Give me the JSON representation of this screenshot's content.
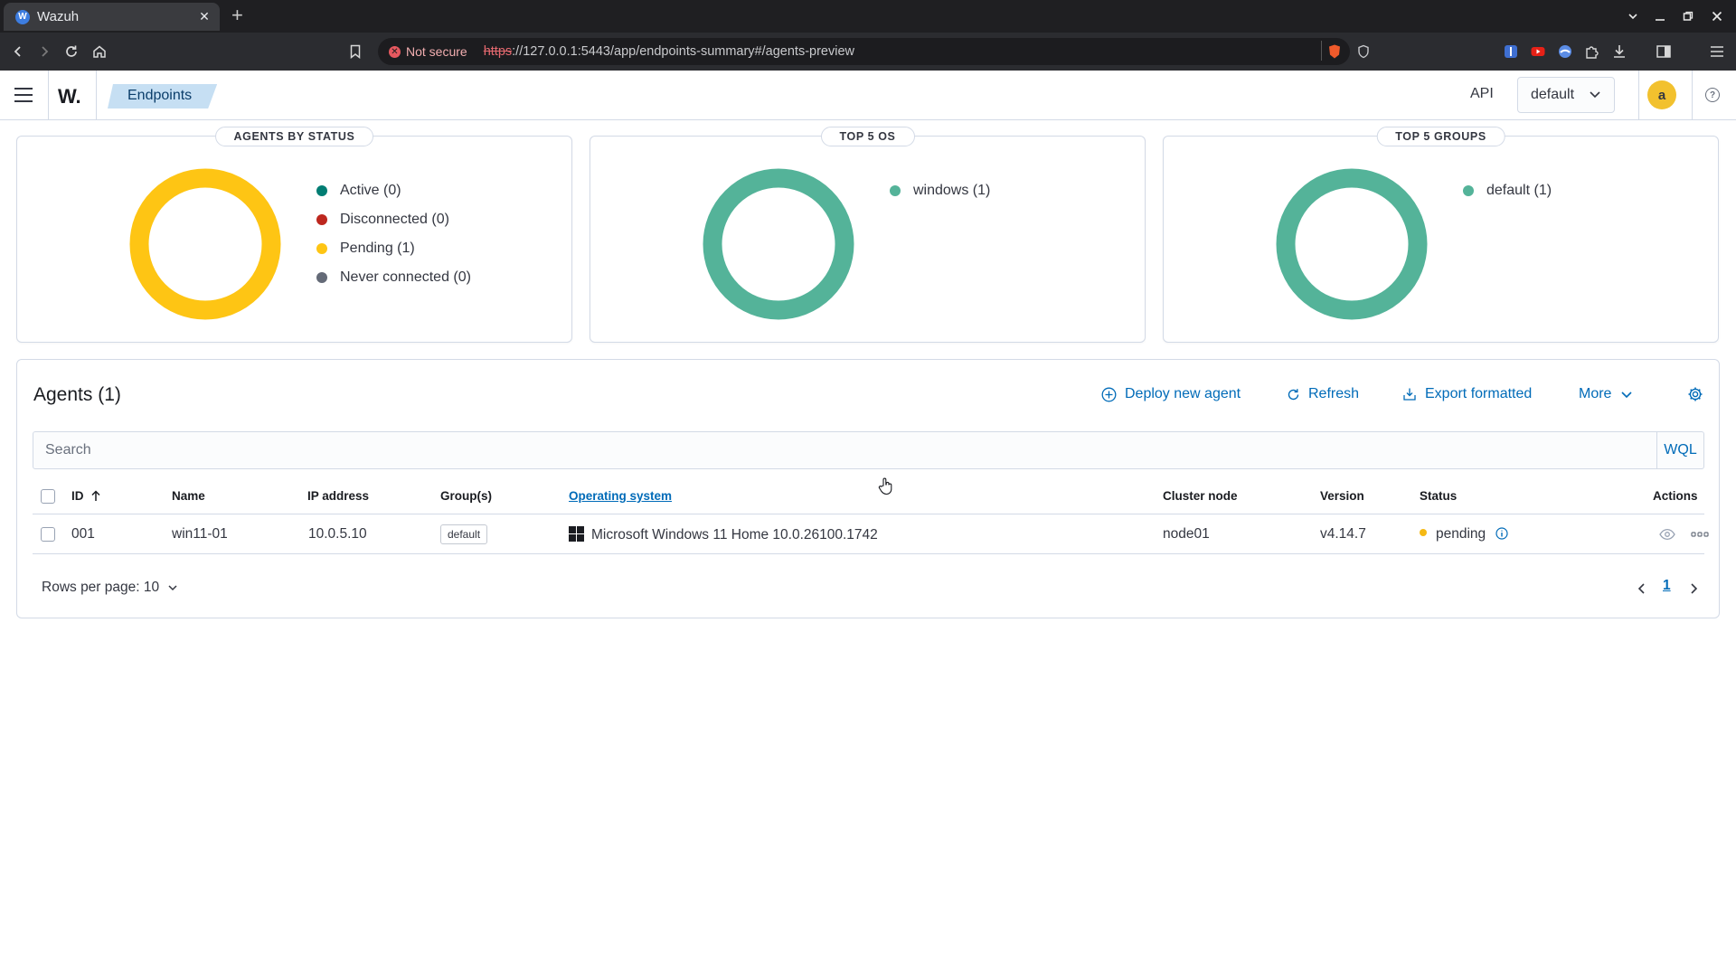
{
  "browser": {
    "tab_title": "Wazuh",
    "tab_favicon": "W",
    "security_label": "Not secure",
    "url_scheme": "https",
    "url_rest": "://127.0.0.1:5443/app/endpoints-summary#/agents-preview"
  },
  "header": {
    "logo": "W.",
    "breadcrumb": "Endpoints",
    "api_label": "API",
    "api_selected": "default",
    "avatar_initial": "a",
    "help_glyph": "?"
  },
  "panels": [
    {
      "title": "AGENTS BY STATUS",
      "legend": [
        {
          "label": "Active (0)",
          "color": "#017d73"
        },
        {
          "label": "Disconnected (0)",
          "color": "#bd271e"
        },
        {
          "label": "Pending (1)",
          "color": "#fec514"
        },
        {
          "label": "Never connected (0)",
          "color": "#646a77"
        }
      ],
      "ring_color": "#fec514"
    },
    {
      "title": "TOP 5 OS",
      "legend": [
        {
          "label": "windows (1)",
          "color": "#54b399"
        }
      ],
      "ring_color": "#54b399"
    },
    {
      "title": "TOP 5 GROUPS",
      "legend": [
        {
          "label": "default (1)",
          "color": "#54b399"
        }
      ],
      "ring_color": "#54b399"
    }
  ],
  "agents": {
    "title": "Agents (1)",
    "actions": {
      "deploy": "Deploy new agent",
      "refresh": "Refresh",
      "export": "Export formatted",
      "more": "More"
    },
    "search_placeholder": "Search",
    "wql": "WQL",
    "columns": {
      "id": "ID",
      "name": "Name",
      "ip": "IP address",
      "groups": "Group(s)",
      "os": "Operating system",
      "cluster": "Cluster node",
      "version": "Version",
      "status": "Status",
      "actions": "Actions"
    },
    "rows": [
      {
        "id": "001",
        "name": "win11-01",
        "ip": "10.0.5.10",
        "group": "default",
        "os": "Microsoft Windows 11 Home 10.0.26100.1742",
        "cluster": "node01",
        "version": "v4.14.7",
        "status": "pending"
      }
    ],
    "rows_per_page": "Rows per page: 10",
    "current_page": "1"
  }
}
